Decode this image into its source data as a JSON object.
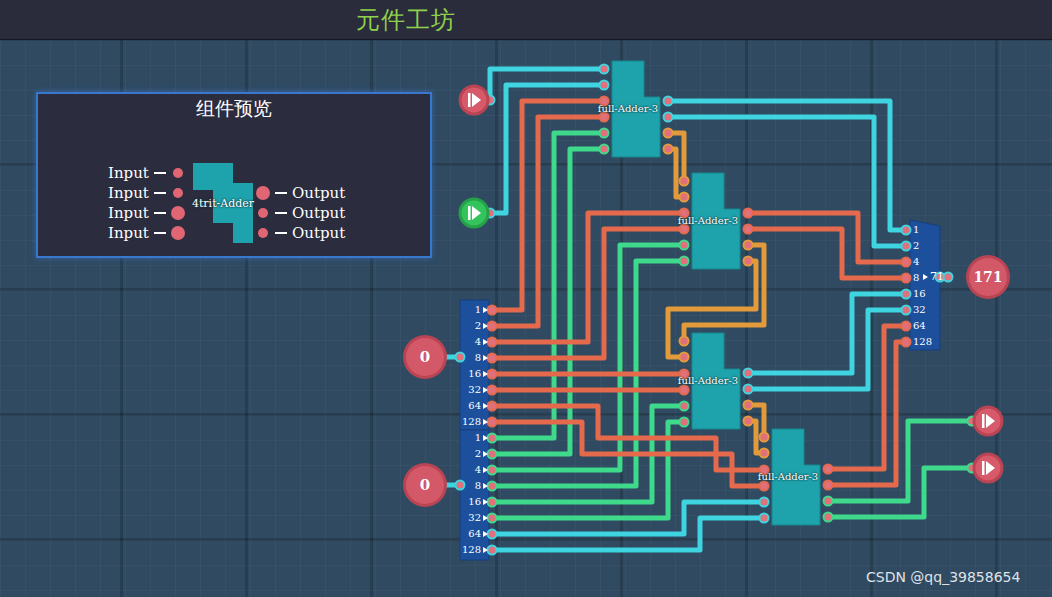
{
  "header": {
    "title": "元件工坊"
  },
  "preview": {
    "title": "组件预览",
    "component": "4trit-Adder",
    "inputs": [
      "Input",
      "Input",
      "Input",
      "Input"
    ],
    "outputs": [
      "Output",
      "Output",
      "Output"
    ]
  },
  "input_pins": [
    {
      "on": false
    },
    {
      "on": true
    }
  ],
  "output_pins": [
    {
      "on": false
    },
    {
      "on": false
    }
  ],
  "adders": [
    {
      "label": "full-Adder-3"
    },
    {
      "label": "full-Adder-3"
    },
    {
      "label": "full-Adder-3"
    },
    {
      "label": "full-Adder-3"
    }
  ],
  "input_splitters": [
    {
      "value": "0",
      "bits": [
        "1",
        "2",
        "4",
        "8",
        "16",
        "32",
        "64",
        "128"
      ]
    },
    {
      "value": "0",
      "bits": [
        "1",
        "2",
        "4",
        "8",
        "16",
        "32",
        "64",
        "128"
      ]
    }
  ],
  "output_joiner": {
    "bits": [
      "1",
      "2",
      "4",
      "8",
      "16",
      "32",
      "64",
      "128"
    ],
    "value": "71",
    "display": "171"
  },
  "watermark": "CSDN @qq_39858654"
}
